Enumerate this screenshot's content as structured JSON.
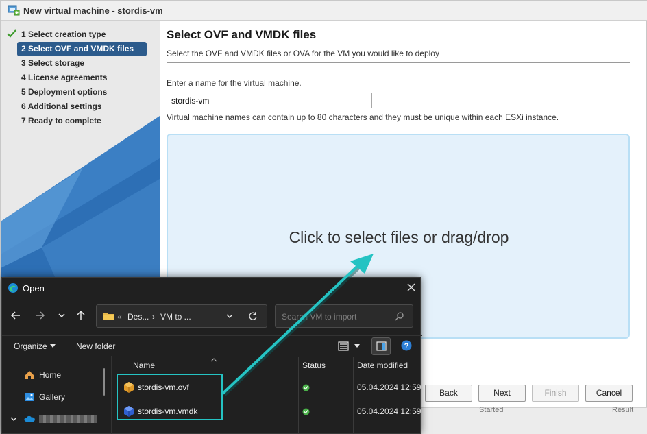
{
  "wizard": {
    "window_title": "New virtual machine - stordis-vm",
    "steps": [
      {
        "label": "1  Select creation type",
        "done": true
      },
      {
        "label": "2  Select OVF and VMDK files",
        "active": true
      },
      {
        "label": "3  Select storage"
      },
      {
        "label": "4  License agreements"
      },
      {
        "label": "5  Deployment options"
      },
      {
        "label": "6  Additional settings"
      },
      {
        "label": "7  Ready to complete"
      }
    ],
    "heading": "Select OVF and VMDK files",
    "subheading": "Select the OVF and VMDK files or OVA for the VM you would like to deploy",
    "name_label": "Enter a name for the virtual machine.",
    "name_value": "stordis-vm",
    "name_hint": "Virtual machine names can contain up to 80 characters and they must be unique within each ESXi instance.",
    "dropzone_text": "Click to select files or drag/drop",
    "buttons": {
      "back": "Back",
      "next": "Next",
      "finish": "Finish",
      "cancel": "Cancel"
    },
    "footer_headers": [
      "Started",
      "Result"
    ],
    "accent_color": "#2c5b8c"
  },
  "open_dialog": {
    "title": "Open",
    "breadcrumb": [
      "«",
      "Des...",
      "›",
      "VM to ..."
    ],
    "search_placeholder": "Search VM to import",
    "organize_label": "Organize",
    "new_folder_label": "New folder",
    "nav_items": [
      {
        "label": "Home",
        "icon": "home-icon"
      },
      {
        "label": "Gallery",
        "icon": "gallery-icon"
      },
      {
        "label": "",
        "icon": "onedrive-icon"
      }
    ],
    "columns": [
      "Name",
      "Status",
      "Date modified"
    ],
    "files": [
      {
        "name": "stordis-vm.ovf",
        "icon": "ovf-file-icon",
        "status": "synced",
        "date": "05.04.2024 12:59"
      },
      {
        "name": "stordis-vm.vmdk",
        "icon": "vmdk-file-icon",
        "status": "synced",
        "date": "05.04.2024 12:59"
      }
    ],
    "highlight_color": "#25c3c3"
  }
}
